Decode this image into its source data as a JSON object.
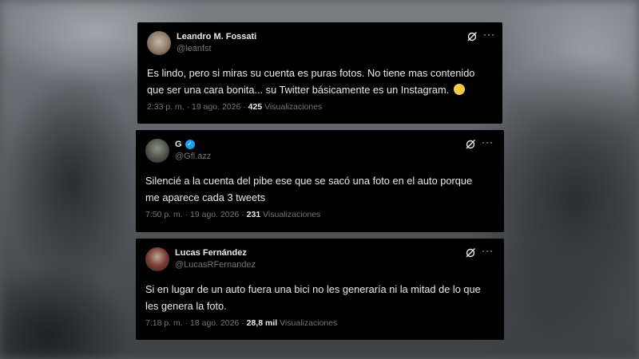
{
  "tweets": [
    {
      "name": "Leandro M. Fossati",
      "handle": "@leanfst",
      "verified": false,
      "text": "Es lindo, pero si miras su cuenta es puras fotos. No tiene mas contenido que ser una cara bonita... su Twitter básicamente es un Instagram.",
      "emoji": "grinning-sweat-emoji",
      "time": "2:33 p. m. · 19 ago. 2026 · ",
      "views": "425",
      "views_label": " Visualizaciones"
    },
    {
      "name": "G",
      "handle": "@Gfl.azz",
      "verified": true,
      "text": "Silencié a la cuenta del pibe ese que se sacó una foto en el auto porque me aparece cada 3 tweets",
      "time": "7:50 p. m. · 19 ago. 2026 · ",
      "views": "231",
      "views_label": " Visualizaciones"
    },
    {
      "name": "Lucas Fernández",
      "handle": "@LucasRFernandez",
      "verified": false,
      "text": "Si en lugar de un auto fuera una bici no les generaría ni la mitad de lo que les genera la foto.",
      "time": "7:18 p. m. · 18 ago. 2026 · ",
      "views": "28,8 mil",
      "views_label": " Visualizaciones"
    }
  ],
  "icons": {
    "grok": "grok-icon",
    "more": "more-options-icon",
    "verified": "verified-badge-icon"
  },
  "colors": {
    "card_bg": "#000000",
    "text": "#e7e9ea",
    "secondary": "#71767b",
    "verified": "#1d9bf0"
  }
}
